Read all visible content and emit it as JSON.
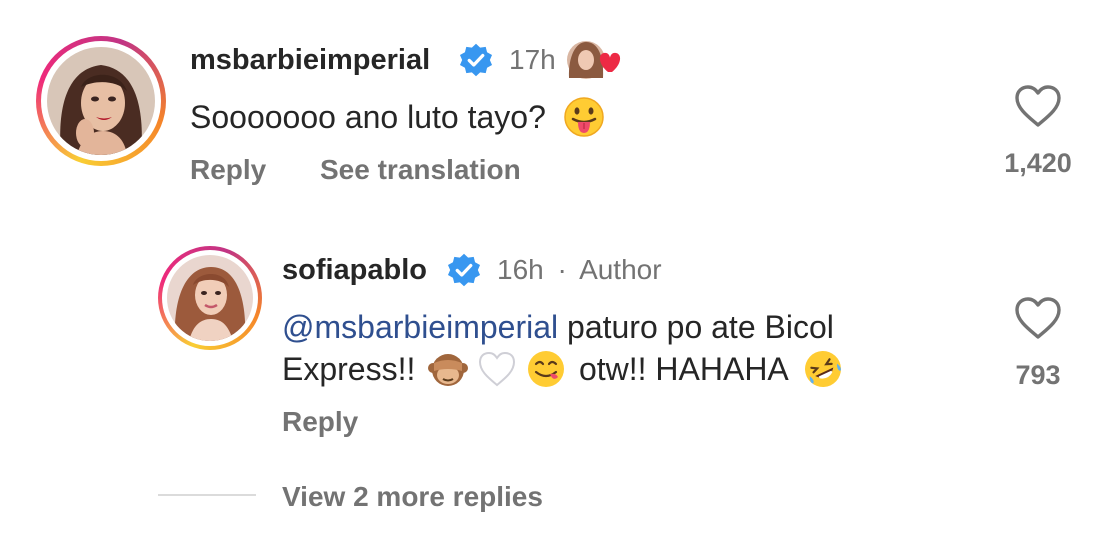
{
  "comment1": {
    "username": "msbarbieimperial",
    "time": "17h",
    "text": "Sooooooo ano luto tayo?",
    "reply_label": "Reply",
    "translate_label": "See translation",
    "likes": "1,420",
    "icons": {
      "verified": "verified-badge-icon",
      "liked_by_author": "author-liked-avatar-icon",
      "emoji": "tongue-emoji-icon",
      "like": "heart-outline-icon"
    }
  },
  "comment2": {
    "username": "sofiapablo",
    "time": "16h",
    "separator": "·",
    "author_label": "Author",
    "mention": "@msbarbieimperial",
    "text_line1": "paturo po ate Bicol",
    "text_line2a": "Express!!",
    "text_line2b": "otw!! HAHAHA",
    "reply_label": "Reply",
    "likes": "793",
    "icons": {
      "verified": "verified-badge-icon",
      "emojis": [
        "see-no-evil-monkey-icon",
        "white-heart-icon",
        "yum-face-icon",
        "rofl-face-icon"
      ],
      "like": "heart-outline-icon"
    }
  },
  "more_replies": {
    "label": "View 2 more replies"
  },
  "colors": {
    "verified": "#3897f0",
    "mention": "#2f4f8f",
    "muted": "#737373",
    "text": "#262626"
  }
}
